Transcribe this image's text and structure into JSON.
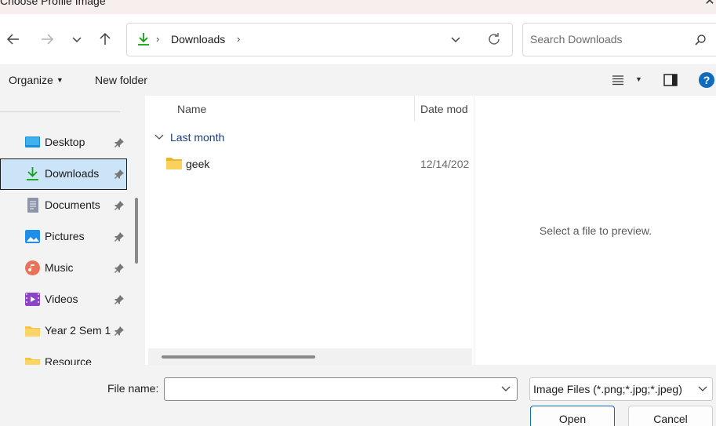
{
  "window": {
    "title": "Choose Profile Image",
    "close_glyph": "✕"
  },
  "nav": {
    "back_icon": "arrow-left-icon",
    "forward_icon": "arrow-right-icon",
    "recent_icon": "chevron-down-icon",
    "up_icon": "arrow-up-icon"
  },
  "address": {
    "crumb": "Downloads",
    "separator": "›"
  },
  "search": {
    "placeholder": "Search Downloads"
  },
  "toolbar": {
    "organize": "Organize",
    "new_folder": "New folder"
  },
  "sidebar": {
    "items": [
      {
        "label": "Desktop",
        "icon": "desktop-icon"
      },
      {
        "label": "Downloads",
        "icon": "downloads-icon",
        "selected": true
      },
      {
        "label": "Documents",
        "icon": "documents-icon"
      },
      {
        "label": "Pictures",
        "icon": "pictures-icon"
      },
      {
        "label": "Music",
        "icon": "music-icon"
      },
      {
        "label": "Videos",
        "icon": "videos-icon"
      },
      {
        "label": "Year 2 Sem 1",
        "icon": "folder-icon"
      },
      {
        "label": "Resource",
        "icon": "folder-icon"
      }
    ]
  },
  "filelist": {
    "columns": {
      "name": "Name",
      "date": "Date mod"
    },
    "group": "Last month",
    "rows": [
      {
        "name": "geek",
        "date": "12/14/202"
      }
    ]
  },
  "preview": {
    "message": "Select a file to preview."
  },
  "bottom": {
    "file_name_label": "File name:",
    "file_name_value": "",
    "file_type": "Image Files (*.png;*.jpg;*.jpeg)",
    "open": "Open",
    "cancel": "Cancel"
  },
  "colors": {
    "accent": "#0f6cbd",
    "selected_bg": "#cce4f7",
    "folder": "#f4c542",
    "download_green": "#13a10e"
  }
}
